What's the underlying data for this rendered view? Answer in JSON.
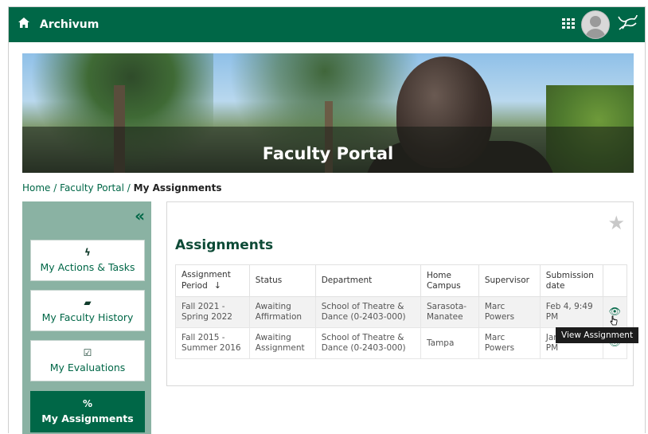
{
  "app": {
    "title": "Archivum"
  },
  "banner": {
    "title": "Faculty Portal"
  },
  "breadcrumb": {
    "home": "Home",
    "portal": "Faculty Portal",
    "current": "My Assignments",
    "separator": "/"
  },
  "sidebar": {
    "collapse_glyph": "«",
    "items": [
      {
        "icon": "bolt-icon",
        "glyph": "ϟ",
        "label": "My Actions & Tasks",
        "active": false
      },
      {
        "icon": "book-icon",
        "glyph": "▰",
        "label": "My Faculty History",
        "active": false
      },
      {
        "icon": "calendar-check-icon",
        "glyph": "☑",
        "label": "My Evaluations",
        "active": false
      },
      {
        "icon": "percent-icon",
        "glyph": "%",
        "label": "My Assignments",
        "active": true
      }
    ]
  },
  "assignments": {
    "heading": "Assignments",
    "columns": [
      "Assignment Period",
      "Status",
      "Department",
      "Home Campus",
      "Supervisor",
      "Submission date",
      ""
    ],
    "sort_indicator": "↓",
    "rows": [
      {
        "period": "Fall 2021 - Spring 2022",
        "status": "Awaiting Affirmation",
        "department": "School of Theatre & Dance (0-2403-000)",
        "campus": "Sarasota-Manatee",
        "supervisor": "Marc Powers",
        "submitted": "Feb 4, 9:49 PM"
      },
      {
        "period": "Fall 2015 - Summer 2016",
        "status": "Awaiting Assignment",
        "department": "School of Theatre & Dance (0-2403-000)",
        "campus": "Tampa",
        "supervisor": "Marc Powers",
        "submitted": "Jan 22, 3:23 PM"
      }
    ],
    "tooltip": "View Assignment"
  },
  "colors": {
    "primary": "#006747",
    "sidebar": "#8ab2a3"
  }
}
